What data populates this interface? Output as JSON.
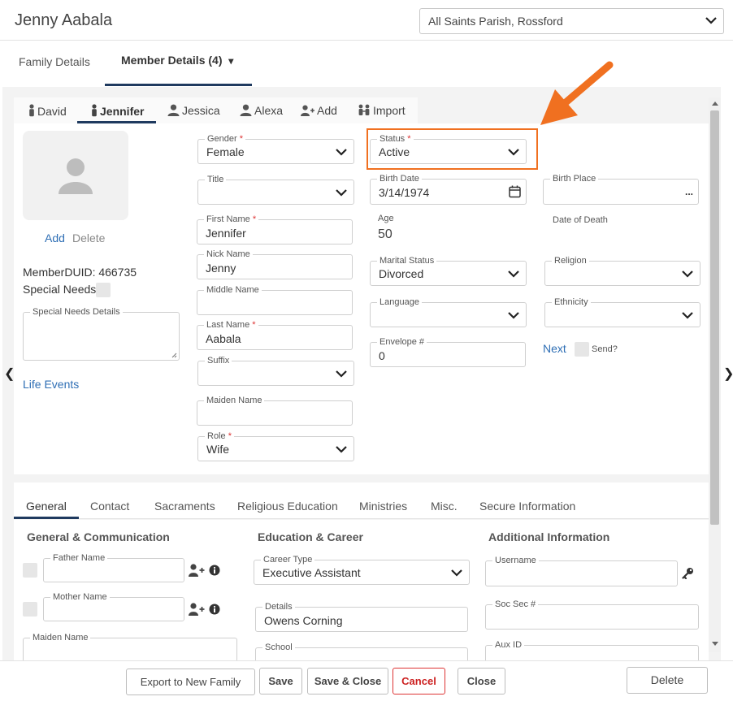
{
  "window": {
    "title": "Jenny Aabala",
    "parish": "All Saints Parish, Rossford"
  },
  "toptabs": {
    "family": "Family Details",
    "member": "Member Details (4)",
    "member_dropdown": "▾"
  },
  "members": {
    "tabs": [
      "David",
      "Jennifer",
      "Jessica",
      "Alexa"
    ],
    "add": "Add",
    "import": "Import",
    "active": "Jennifer"
  },
  "photo": {
    "add": "Add",
    "delete": "Delete"
  },
  "member": {
    "duid_label": "MemberDUID: 466735",
    "special_needs_label": "Special Needs",
    "special_needs_details_label": "Special Needs Details",
    "life_events": "Life Events"
  },
  "col1": {
    "gender": {
      "label": "Gender",
      "value": "Female"
    },
    "title": {
      "label": "Title",
      "value": ""
    },
    "first_name": {
      "label": "First Name",
      "value": "Jennifer"
    },
    "nick_name": {
      "label": "Nick Name",
      "value": "Jenny"
    },
    "middle_name": {
      "label": "Middle Name",
      "value": ""
    },
    "last_name": {
      "label": "Last Name",
      "value": "Aabala"
    },
    "suffix": {
      "label": "Suffix",
      "value": ""
    },
    "maiden_name": {
      "label": "Maiden Name",
      "value": ""
    },
    "role": {
      "label": "Role",
      "value": "Wife"
    }
  },
  "col2": {
    "status": {
      "label": "Status",
      "value": "Active"
    },
    "birth_date": {
      "label": "Birth Date",
      "value": "3/14/1974"
    },
    "age": {
      "label": "Age",
      "value": "50"
    },
    "marital_status": {
      "label": "Marital Status",
      "value": "Divorced"
    },
    "language": {
      "label": "Language",
      "value": ""
    },
    "envelope": {
      "label": "Envelope #",
      "value": "0"
    }
  },
  "col3": {
    "birth_place": {
      "label": "Birth Place",
      "ellipsis": "..."
    },
    "date_of_death": {
      "label": "Date of Death"
    },
    "religion": {
      "label": "Religion",
      "value": ""
    },
    "ethnicity": {
      "label": "Ethnicity",
      "value": ""
    },
    "next": "Next",
    "send": "Send?"
  },
  "bottom_tabs": [
    "General",
    "Contact",
    "Sacraments",
    "Religious Education",
    "Ministries",
    "Misc.",
    "Secure Information"
  ],
  "general": {
    "sec1": "General & Communication",
    "sec2": "Education & Career",
    "sec3": "Additional Information",
    "father_name": "Father Name",
    "mother_name": "Mother Name",
    "maiden_name": "Maiden Name",
    "career_type": {
      "label": "Career Type",
      "value": "Executive Assistant"
    },
    "details": {
      "label": "Details",
      "value": "Owens Corning"
    },
    "school": {
      "label": "School"
    },
    "username": {
      "label": "Username"
    },
    "soc_sec": {
      "label": "Soc Sec #"
    },
    "aux_id": {
      "label": "Aux ID"
    }
  },
  "footer": {
    "export": "Export to New Family",
    "save": "Save",
    "save_close": "Save & Close",
    "cancel": "Cancel",
    "close": "Close",
    "delete": "Delete"
  },
  "colors": {
    "accent": "#1f3a5f",
    "link": "#2f6fb5",
    "highlight": "#f07020",
    "cancel": "#dd3333"
  }
}
